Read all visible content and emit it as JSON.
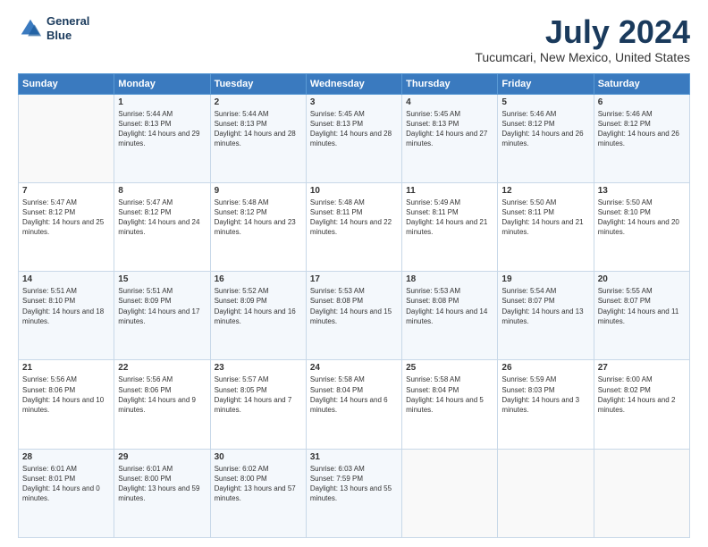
{
  "logo": {
    "line1": "General",
    "line2": "Blue"
  },
  "title": "July 2024",
  "subtitle": "Tucumcari, New Mexico, United States",
  "header": {
    "days": [
      "Sunday",
      "Monday",
      "Tuesday",
      "Wednesday",
      "Thursday",
      "Friday",
      "Saturday"
    ]
  },
  "weeks": [
    [
      {
        "day": "",
        "sunrise": "",
        "sunset": "",
        "daylight": ""
      },
      {
        "day": "1",
        "sunrise": "Sunrise: 5:44 AM",
        "sunset": "Sunset: 8:13 PM",
        "daylight": "Daylight: 14 hours and 29 minutes."
      },
      {
        "day": "2",
        "sunrise": "Sunrise: 5:44 AM",
        "sunset": "Sunset: 8:13 PM",
        "daylight": "Daylight: 14 hours and 28 minutes."
      },
      {
        "day": "3",
        "sunrise": "Sunrise: 5:45 AM",
        "sunset": "Sunset: 8:13 PM",
        "daylight": "Daylight: 14 hours and 28 minutes."
      },
      {
        "day": "4",
        "sunrise": "Sunrise: 5:45 AM",
        "sunset": "Sunset: 8:13 PM",
        "daylight": "Daylight: 14 hours and 27 minutes."
      },
      {
        "day": "5",
        "sunrise": "Sunrise: 5:46 AM",
        "sunset": "Sunset: 8:12 PM",
        "daylight": "Daylight: 14 hours and 26 minutes."
      },
      {
        "day": "6",
        "sunrise": "Sunrise: 5:46 AM",
        "sunset": "Sunset: 8:12 PM",
        "daylight": "Daylight: 14 hours and 26 minutes."
      }
    ],
    [
      {
        "day": "7",
        "sunrise": "Sunrise: 5:47 AM",
        "sunset": "Sunset: 8:12 PM",
        "daylight": "Daylight: 14 hours and 25 minutes."
      },
      {
        "day": "8",
        "sunrise": "Sunrise: 5:47 AM",
        "sunset": "Sunset: 8:12 PM",
        "daylight": "Daylight: 14 hours and 24 minutes."
      },
      {
        "day": "9",
        "sunrise": "Sunrise: 5:48 AM",
        "sunset": "Sunset: 8:12 PM",
        "daylight": "Daylight: 14 hours and 23 minutes."
      },
      {
        "day": "10",
        "sunrise": "Sunrise: 5:48 AM",
        "sunset": "Sunset: 8:11 PM",
        "daylight": "Daylight: 14 hours and 22 minutes."
      },
      {
        "day": "11",
        "sunrise": "Sunrise: 5:49 AM",
        "sunset": "Sunset: 8:11 PM",
        "daylight": "Daylight: 14 hours and 21 minutes."
      },
      {
        "day": "12",
        "sunrise": "Sunrise: 5:50 AM",
        "sunset": "Sunset: 8:11 PM",
        "daylight": "Daylight: 14 hours and 21 minutes."
      },
      {
        "day": "13",
        "sunrise": "Sunrise: 5:50 AM",
        "sunset": "Sunset: 8:10 PM",
        "daylight": "Daylight: 14 hours and 20 minutes."
      }
    ],
    [
      {
        "day": "14",
        "sunrise": "Sunrise: 5:51 AM",
        "sunset": "Sunset: 8:10 PM",
        "daylight": "Daylight: 14 hours and 18 minutes."
      },
      {
        "day": "15",
        "sunrise": "Sunrise: 5:51 AM",
        "sunset": "Sunset: 8:09 PM",
        "daylight": "Daylight: 14 hours and 17 minutes."
      },
      {
        "day": "16",
        "sunrise": "Sunrise: 5:52 AM",
        "sunset": "Sunset: 8:09 PM",
        "daylight": "Daylight: 14 hours and 16 minutes."
      },
      {
        "day": "17",
        "sunrise": "Sunrise: 5:53 AM",
        "sunset": "Sunset: 8:08 PM",
        "daylight": "Daylight: 14 hours and 15 minutes."
      },
      {
        "day": "18",
        "sunrise": "Sunrise: 5:53 AM",
        "sunset": "Sunset: 8:08 PM",
        "daylight": "Daylight: 14 hours and 14 minutes."
      },
      {
        "day": "19",
        "sunrise": "Sunrise: 5:54 AM",
        "sunset": "Sunset: 8:07 PM",
        "daylight": "Daylight: 14 hours and 13 minutes."
      },
      {
        "day": "20",
        "sunrise": "Sunrise: 5:55 AM",
        "sunset": "Sunset: 8:07 PM",
        "daylight": "Daylight: 14 hours and 11 minutes."
      }
    ],
    [
      {
        "day": "21",
        "sunrise": "Sunrise: 5:56 AM",
        "sunset": "Sunset: 8:06 PM",
        "daylight": "Daylight: 14 hours and 10 minutes."
      },
      {
        "day": "22",
        "sunrise": "Sunrise: 5:56 AM",
        "sunset": "Sunset: 8:06 PM",
        "daylight": "Daylight: 14 hours and 9 minutes."
      },
      {
        "day": "23",
        "sunrise": "Sunrise: 5:57 AM",
        "sunset": "Sunset: 8:05 PM",
        "daylight": "Daylight: 14 hours and 7 minutes."
      },
      {
        "day": "24",
        "sunrise": "Sunrise: 5:58 AM",
        "sunset": "Sunset: 8:04 PM",
        "daylight": "Daylight: 14 hours and 6 minutes."
      },
      {
        "day": "25",
        "sunrise": "Sunrise: 5:58 AM",
        "sunset": "Sunset: 8:04 PM",
        "daylight": "Daylight: 14 hours and 5 minutes."
      },
      {
        "day": "26",
        "sunrise": "Sunrise: 5:59 AM",
        "sunset": "Sunset: 8:03 PM",
        "daylight": "Daylight: 14 hours and 3 minutes."
      },
      {
        "day": "27",
        "sunrise": "Sunrise: 6:00 AM",
        "sunset": "Sunset: 8:02 PM",
        "daylight": "Daylight: 14 hours and 2 minutes."
      }
    ],
    [
      {
        "day": "28",
        "sunrise": "Sunrise: 6:01 AM",
        "sunset": "Sunset: 8:01 PM",
        "daylight": "Daylight: 14 hours and 0 minutes."
      },
      {
        "day": "29",
        "sunrise": "Sunrise: 6:01 AM",
        "sunset": "Sunset: 8:00 PM",
        "daylight": "Daylight: 13 hours and 59 minutes."
      },
      {
        "day": "30",
        "sunrise": "Sunrise: 6:02 AM",
        "sunset": "Sunset: 8:00 PM",
        "daylight": "Daylight: 13 hours and 57 minutes."
      },
      {
        "day": "31",
        "sunrise": "Sunrise: 6:03 AM",
        "sunset": "Sunset: 7:59 PM",
        "daylight": "Daylight: 13 hours and 55 minutes."
      },
      {
        "day": "",
        "sunrise": "",
        "sunset": "",
        "daylight": ""
      },
      {
        "day": "",
        "sunrise": "",
        "sunset": "",
        "daylight": ""
      },
      {
        "day": "",
        "sunrise": "",
        "sunset": "",
        "daylight": ""
      }
    ]
  ]
}
